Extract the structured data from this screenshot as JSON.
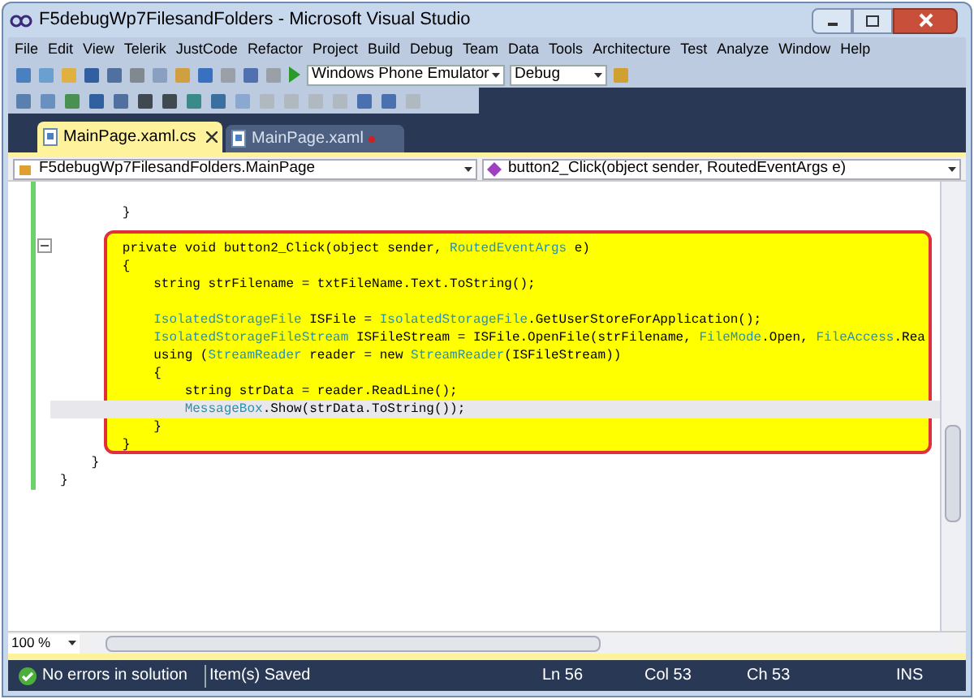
{
  "window": {
    "title": "F5debugWp7FilesandFolders - Microsoft Visual Studio"
  },
  "menu": [
    "File",
    "Edit",
    "View",
    "Telerik",
    "JustCode",
    "Refactor",
    "Project",
    "Build",
    "Debug",
    "Team",
    "Data",
    "Tools",
    "Architecture",
    "Test",
    "Analyze",
    "Window",
    "Help"
  ],
  "toolbar": {
    "target": "Windows Phone Emulator",
    "configuration": "Debug"
  },
  "tabs": [
    {
      "label": "MainPage.xaml.cs",
      "selected": true,
      "modified": false
    },
    {
      "label": "MainPage.xaml",
      "selected": false,
      "modified": true
    }
  ],
  "navigation": {
    "type": "F5debugWp7FilesandFolders.MainPage",
    "member": "button2_Click(object sender, RoutedEventArgs e)"
  },
  "code": [
    {
      "kind": "blank"
    },
    {
      "segments": [
        {
          "text": "        }",
          "kind": "plain"
        }
      ]
    },
    {
      "kind": "blank"
    },
    {
      "segments": [
        {
          "text": "        private void button2_Click(object sender, ",
          "kind": "plain"
        },
        {
          "text": "RoutedEventArgs",
          "kind": "type"
        },
        {
          "text": " e)",
          "kind": "plain"
        }
      ]
    },
    {
      "segments": [
        {
          "text": "        {",
          "kind": "plain"
        }
      ]
    },
    {
      "segments": [
        {
          "text": "            string strFilename = txtFileName.Text.ToString();",
          "kind": "plain"
        }
      ]
    },
    {
      "kind": "blank"
    },
    {
      "segments": [
        {
          "text": "            IsolatedStorageFile",
          "kind": "type"
        },
        {
          "text": " ISFile = ",
          "kind": "plain"
        },
        {
          "text": "IsolatedStorageFile",
          "kind": "type"
        },
        {
          "text": ".GetUserStoreForApplication();",
          "kind": "plain"
        }
      ]
    },
    {
      "segments": [
        {
          "text": "            IsolatedStorageFileStream",
          "kind": "type"
        },
        {
          "text": " ISFileStream = ISFile.OpenFile(strFilename, ",
          "kind": "plain"
        },
        {
          "text": "FileMode",
          "kind": "type"
        },
        {
          "text": ".Open, ",
          "kind": "plain"
        },
        {
          "text": "FileAccess",
          "kind": "type"
        },
        {
          "text": ".Rea",
          "kind": "plain"
        }
      ]
    },
    {
      "segments": [
        {
          "text": "            using (",
          "kind": "plain"
        },
        {
          "text": "StreamReader",
          "kind": "type"
        },
        {
          "text": " reader = new ",
          "kind": "plain"
        },
        {
          "text": "StreamReader",
          "kind": "type"
        },
        {
          "text": "(ISFileStream))",
          "kind": "plain"
        }
      ]
    },
    {
      "segments": [
        {
          "text": "            {",
          "kind": "plain"
        }
      ]
    },
    {
      "segments": [
        {
          "text": "                string strData = reader.ReadLine();",
          "kind": "plain"
        }
      ]
    },
    {
      "segments": [
        {
          "text": "                MessageBox",
          "kind": "type"
        },
        {
          "text": ".Show(strData.ToString());",
          "kind": "plain"
        }
      ],
      "current": true
    },
    {
      "segments": [
        {
          "text": "            }",
          "kind": "plain"
        }
      ]
    },
    {
      "segments": [
        {
          "text": "        }",
          "kind": "plain"
        }
      ]
    },
    {
      "segments": [
        {
          "text": "    }",
          "kind": "plain"
        }
      ]
    },
    {
      "segments": [
        {
          "text": "}",
          "kind": "plain"
        }
      ]
    }
  ],
  "zoom": "100 %",
  "status_bar": {
    "message": "No errors in solution",
    "saved": "Item(s) Saved",
    "line": "Ln 56",
    "column": "Col 53",
    "char": "Ch 53",
    "mode": "INS"
  }
}
